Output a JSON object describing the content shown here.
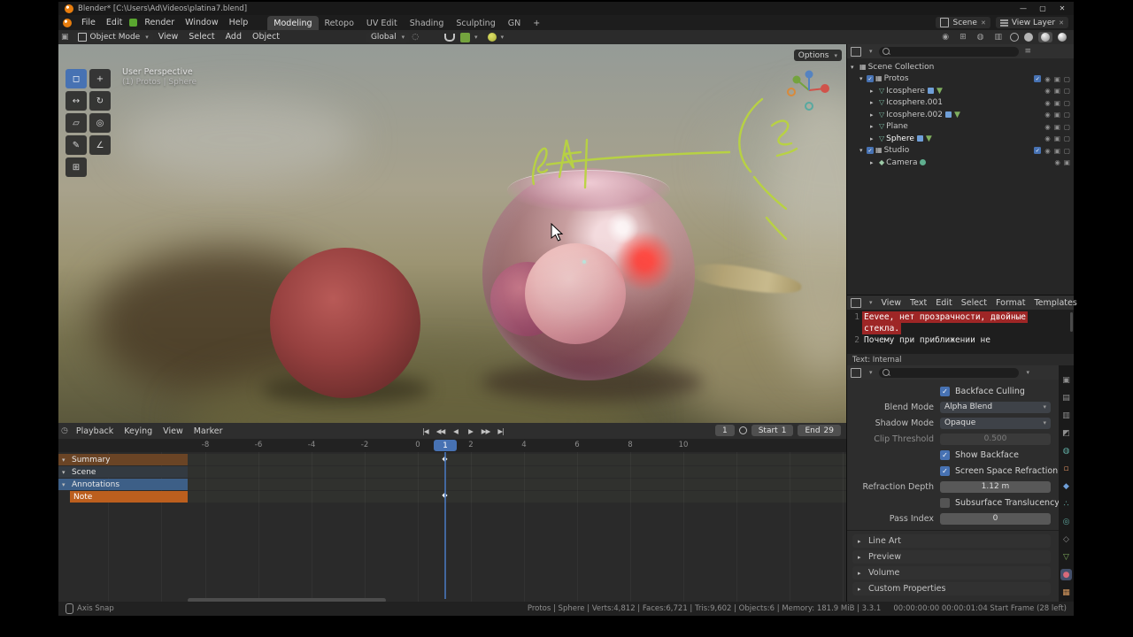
{
  "titlebar": {
    "title": "Blender* [C:\\Users\\Ad\\Videos\\platina7.blend]",
    "minimize": "—",
    "maximize": "▢",
    "close": "✕"
  },
  "topbar": {
    "menus": [
      "File",
      "Edit",
      "Render",
      "Window",
      "Help"
    ],
    "workspaces": [
      "Modeling",
      "Retopo",
      "UV Edit",
      "Shading",
      "Sculpting",
      "GN"
    ],
    "add_workspace": "+",
    "scene_label": "Scene",
    "view_layer_label": "View Layer"
  },
  "tool_header": {
    "mode": "Object Mode",
    "menus": [
      "View",
      "Select",
      "Add",
      "Object"
    ],
    "orientation": "Global"
  },
  "viewport": {
    "options_label": "Options",
    "view_label": "User Perspective",
    "context_label": "(1) Protos | Sphere"
  },
  "outliner": {
    "root_label": "Scene Collection",
    "items": [
      {
        "label": "Protos"
      },
      {
        "label": "Icosphere"
      },
      {
        "label": "Icosphere.001"
      },
      {
        "label": "Icosphere.002"
      },
      {
        "label": "Plane"
      },
      {
        "label": "Sphere"
      },
      {
        "label": "Studio"
      },
      {
        "label": "Camera"
      }
    ]
  },
  "text_editor": {
    "menus": [
      "View",
      "Text",
      "Edit",
      "Select",
      "Format",
      "Templates"
    ],
    "lines": [
      {
        "num": "1",
        "text": "Eevee, нет прозрачности, двойные"
      },
      {
        "num": "",
        "text": "стекла."
      },
      {
        "num": "2",
        "text": "Почему при приближении не"
      }
    ],
    "footer": "Text: Internal"
  },
  "properties": {
    "rows": [
      {
        "label": "Backface Culling"
      },
      {
        "label": "Blend Mode",
        "value": "Alpha Blend"
      },
      {
        "label": "Shadow Mode",
        "value": "Opaque"
      },
      {
        "label": "Clip Threshold",
        "value": "0.500"
      },
      {
        "label": "Show Backface"
      },
      {
        "label": "Screen Space Refraction"
      },
      {
        "label": "Refraction Depth",
        "value": "1.12 m"
      },
      {
        "label": "Subsurface Translucency"
      },
      {
        "label": "Pass Index",
        "value": "0"
      }
    ],
    "sections": [
      "Line Art",
      "Preview",
      "Volume",
      "Custom Properties"
    ]
  },
  "timeline": {
    "menus": [
      "Playback",
      "Keying",
      "View",
      "Marker"
    ],
    "transport": [
      "|◀",
      "◀◀",
      "◀",
      "▶",
      "▶▶",
      "▶|"
    ],
    "current_frame": "1",
    "start_label": "Start",
    "start_value": "1",
    "end_label": "End",
    "end_value": "29",
    "ticks": [
      "-8",
      "-6",
      "-4",
      "-2",
      "0",
      "2",
      "4",
      "6",
      "8",
      "10"
    ],
    "channels": [
      {
        "label": "Summary"
      },
      {
        "label": "Scene"
      },
      {
        "label": "Annotations"
      },
      {
        "label": "Note"
      }
    ]
  },
  "status_bar": {
    "left": "Axis Snap",
    "stats": "Protos | Sphere | Verts:4,812 | Faces:6,721 | Tris:9,602 | Objects:6 | Memory: 181.9 MiB | 3.3.1",
    "extra": "00:00:00:00  00:00:01:04  Start Frame (28 left)"
  },
  "icons": {
    "dropdown-chevron": "▾",
    "expand-arrow": "▸",
    "collapse-arrow": "▾",
    "checkmark": "✓",
    "eye": "◉",
    "camera-visibility": "▣",
    "monitor-visibility": "▢",
    "mesh": "▽",
    "collection": "▦",
    "keyframe": "◆"
  },
  "colors": {
    "accent": "#4772b3",
    "selection_orange": "#bc5f1e",
    "annotation_green": "#b9d43f"
  }
}
